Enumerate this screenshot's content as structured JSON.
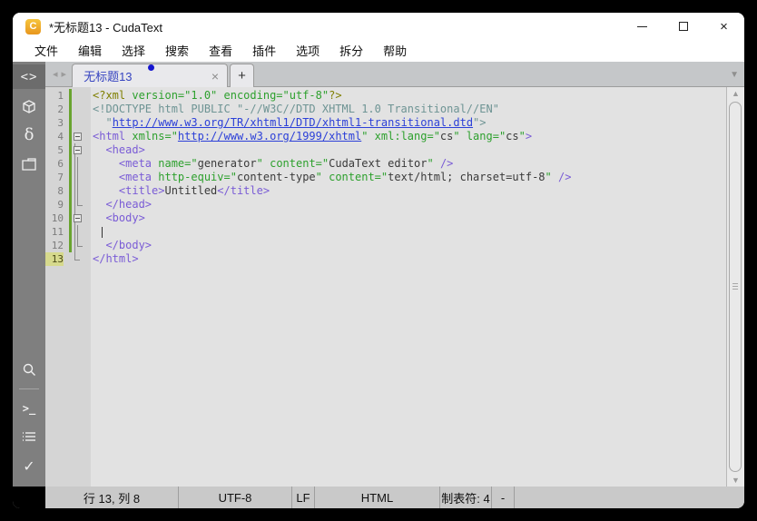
{
  "window": {
    "title": "*无标题13 - CudaText",
    "app_icon_letter": "C"
  },
  "menu": {
    "items": [
      {
        "label": "文件"
      },
      {
        "label": "编辑"
      },
      {
        "label": "选择"
      },
      {
        "label": "搜索"
      },
      {
        "label": "查看"
      },
      {
        "label": "插件"
      },
      {
        "label": "选项"
      },
      {
        "label": "拆分"
      },
      {
        "label": "帮助"
      }
    ]
  },
  "tabbar": {
    "tab_label": "无标题13",
    "modified": true,
    "icons": {
      "prev": "◂",
      "next": "▸",
      "close": "×",
      "new_tab": "+",
      "tab_menu": "▼"
    }
  },
  "sidebar": {
    "icons": {
      "code_tree": "<>",
      "delta": "δ",
      "console": ">_",
      "check": "✓"
    }
  },
  "editor": {
    "current_line": 13,
    "lines": [
      {
        "num": 1,
        "changed": true,
        "fold": "",
        "tokens": [
          [
            "pi",
            "<?xml "
          ],
          [
            "attr",
            "version=\"1.0\" encoding=\"utf-8\""
          ],
          [
            "pi",
            "?>"
          ]
        ]
      },
      {
        "num": 2,
        "changed": true,
        "fold": "",
        "tokens": [
          [
            "doctype",
            "<!DOCTYPE html PUBLIC \"-//W3C//DTD XHTML 1.0 Transitional//EN\""
          ]
        ]
      },
      {
        "num": 3,
        "changed": true,
        "fold": "",
        "tokens": [
          [
            "plain",
            "  "
          ],
          [
            "doctype",
            "\""
          ],
          [
            "url",
            "http://www.w3.org/TR/xhtml1/DTD/xhtml1-transitional.dtd"
          ],
          [
            "doctype",
            "\">"
          ]
        ]
      },
      {
        "num": 4,
        "changed": true,
        "fold": "box",
        "tokens": [
          [
            "tag",
            "<html"
          ],
          [
            "attr",
            " xmlns=\""
          ],
          [
            "url",
            "http://www.w3.org/1999/xhtml"
          ],
          [
            "attr",
            "\" xml:lang=\""
          ],
          [
            "val",
            "cs"
          ],
          [
            "attr",
            "\" lang=\""
          ],
          [
            "val",
            "cs"
          ],
          [
            "attr",
            "\""
          ],
          [
            "tag",
            ">"
          ]
        ]
      },
      {
        "num": 5,
        "changed": true,
        "fold": "boxo",
        "tokens": [
          [
            "plain",
            "  "
          ],
          [
            "tag",
            "<head>"
          ]
        ]
      },
      {
        "num": 6,
        "changed": true,
        "fold": "vlo",
        "tokens": [
          [
            "plain",
            "    "
          ],
          [
            "tag",
            "<meta"
          ],
          [
            "attr",
            " name=\""
          ],
          [
            "val",
            "generator"
          ],
          [
            "attr",
            "\" content=\""
          ],
          [
            "val",
            "CudaText editor"
          ],
          [
            "attr",
            "\""
          ],
          [
            "tag",
            " />"
          ]
        ]
      },
      {
        "num": 7,
        "changed": true,
        "fold": "vlo",
        "tokens": [
          [
            "plain",
            "    "
          ],
          [
            "tag",
            "<meta"
          ],
          [
            "attr",
            " http-equiv=\""
          ],
          [
            "val",
            "content-type"
          ],
          [
            "attr",
            "\" content=\""
          ],
          [
            "val",
            "text/html; charset=utf-8"
          ],
          [
            "attr",
            "\""
          ],
          [
            "tag",
            " />"
          ]
        ]
      },
      {
        "num": 8,
        "changed": true,
        "fold": "vlo",
        "tokens": [
          [
            "plain",
            "    "
          ],
          [
            "tag",
            "<title>"
          ],
          [
            "val",
            "Untitled"
          ],
          [
            "tag",
            "</title>"
          ]
        ]
      },
      {
        "num": 9,
        "changed": true,
        "fold": "endo",
        "tokens": [
          [
            "plain",
            "  "
          ],
          [
            "tag",
            "</head>"
          ]
        ]
      },
      {
        "num": 10,
        "changed": true,
        "fold": "boxo",
        "tokens": [
          [
            "plain",
            "  "
          ],
          [
            "tag",
            "<body>"
          ]
        ]
      },
      {
        "num": 11,
        "changed": true,
        "fold": "vlo",
        "tokens": [
          [
            "caret",
            ""
          ]
        ]
      },
      {
        "num": 12,
        "changed": true,
        "fold": "endo",
        "tokens": [
          [
            "plain",
            "  "
          ],
          [
            "tag",
            "</body>"
          ]
        ]
      },
      {
        "num": 13,
        "changed": false,
        "fold": "oend",
        "tokens": [
          [
            "tag",
            "</html>"
          ]
        ]
      }
    ]
  },
  "statusbar": {
    "cells": [
      {
        "label": "行 13, 列 8"
      },
      {
        "label": "UTF-8"
      },
      {
        "label": "LF"
      },
      {
        "label": "HTML"
      },
      {
        "label": "制表符: 4"
      },
      {
        "label": "-"
      },
      {
        "label": ""
      }
    ]
  },
  "colors": {
    "accent_tab_text": "#3644c0",
    "modified_dot": "#1515cf",
    "changed_gutter_bar": "#69a42f",
    "current_line_gutter": "#d6d98c",
    "syntax_tag": "#7a5cd6",
    "syntax_attr": "#2da02d",
    "syntax_pi": "#7f7f00",
    "syntax_doctype": "#6e9494",
    "syntax_url": "#2c40d8",
    "app_icon": "#eda72b"
  }
}
